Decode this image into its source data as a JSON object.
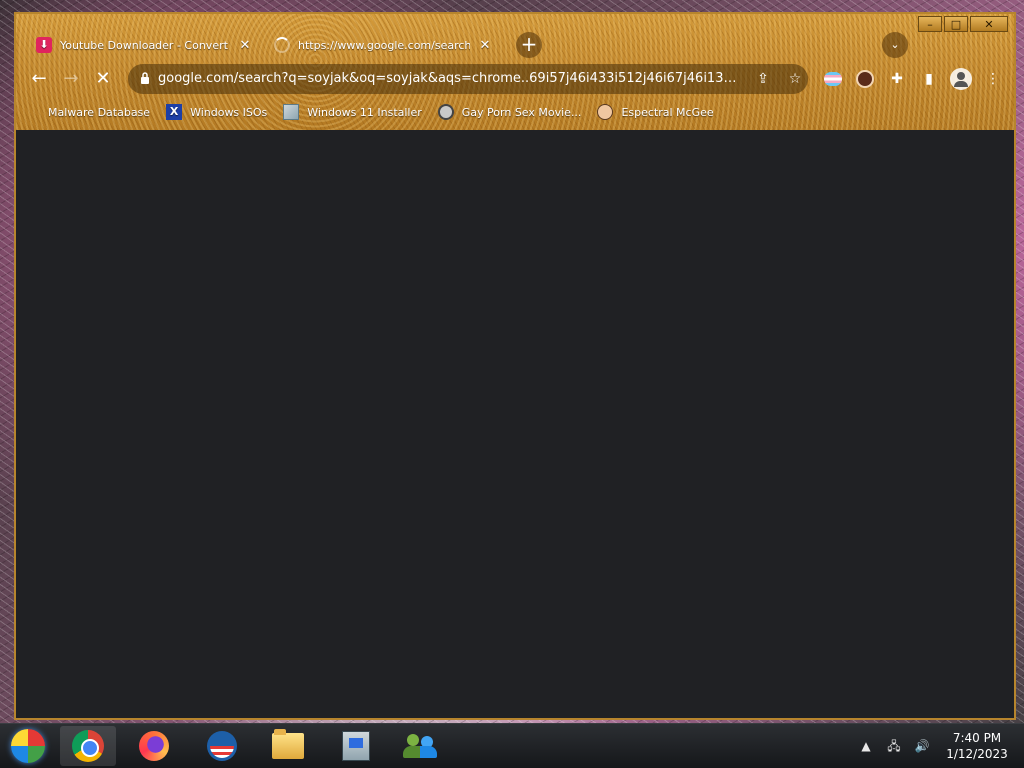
{
  "browser": {
    "tabs": [
      {
        "title": "Youtube Downloader - Convert & ...",
        "favicon": "download-icon",
        "active": false,
        "close_label": "✕"
      },
      {
        "title": "https://www.google.com/search?q...",
        "favicon": "loading-spinner",
        "active": true,
        "close_label": "✕"
      }
    ],
    "new_tab_label": "+",
    "tab_search_label": "⌄",
    "window_controls": {
      "minimize": "–",
      "maximize": "□",
      "close": "✕"
    },
    "toolbar": {
      "back_label": "←",
      "forward_label": "→",
      "stop_label": "✕",
      "url": "google.com/search?q=soyjak&oq=soyjak&aqs=chrome..69i57j46i433i512j46i67j46i131i4...",
      "share_label": "⇪",
      "bookmark_label": "☆",
      "extensions_label": "✚",
      "side_panel_label": "▮",
      "menu_label": "⋮"
    },
    "bookmarks": [
      {
        "label": "Malware Database",
        "icon": "blank-icon"
      },
      {
        "label": "Windows ISOs",
        "icon": "x-icon"
      },
      {
        "label": "Windows 11 Installer",
        "icon": "windows-installer-icon"
      },
      {
        "label": "Gay Porn Sex Movie...",
        "icon": "disk-icon"
      },
      {
        "label": "Espectral McGee",
        "icon": "face-icon"
      }
    ],
    "bookmark_x_glyph": "X"
  },
  "taskbar": {
    "items": [
      "start",
      "chrome",
      "firefox",
      "obama",
      "file-explorer",
      "setup",
      "people"
    ],
    "clock_time": "7:40 PM",
    "clock_date": "1/12/2023",
    "tray_glyphs": {
      "chevron": "▲",
      "network": "🖧",
      "volume": "🔊"
    }
  },
  "colors": {
    "frame_accent": "#c1862c",
    "content_bg": "#202124",
    "taskbar_bg": "#15171a"
  }
}
